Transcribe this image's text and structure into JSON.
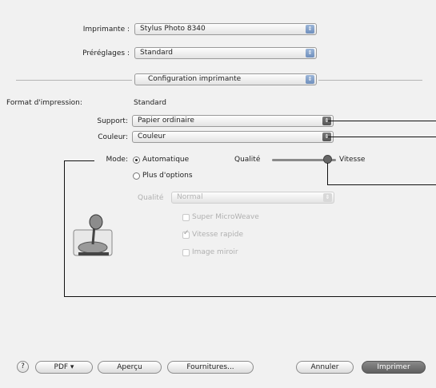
{
  "printer": {
    "label": "Imprimante :",
    "value": "Stylus Photo 8340"
  },
  "presets": {
    "label": "Préréglages :",
    "value": "Standard"
  },
  "panel": {
    "value": "Configuration imprimante"
  },
  "print_format": {
    "label": "Format d'impression:",
    "value": "Standard"
  },
  "media": {
    "label": "Support:",
    "value": "Papier ordinaire"
  },
  "color": {
    "label": "Couleur:",
    "value": "Couleur"
  },
  "mode": {
    "label": "Mode:",
    "automatic_label": "Automatique",
    "more_options_label": "Plus d'options",
    "selected": "automatic"
  },
  "slider": {
    "left_label": "Qualité",
    "right_label": "Vitesse",
    "position_fraction": 0.85
  },
  "quality": {
    "label": "Qualité",
    "value": "Normal"
  },
  "options": {
    "super_microweave": "Super MicroWeave",
    "high_speed": "Vitesse rapide",
    "mirror_image": "Image miroir"
  },
  "footer": {
    "help": "?",
    "pdf": "PDF ▾",
    "preview": "Aperçu",
    "supplies": "Fournitures...",
    "cancel": "Annuler",
    "print": "Imprimer"
  }
}
